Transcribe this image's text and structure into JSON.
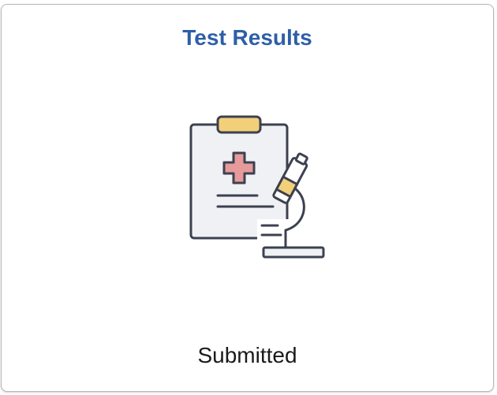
{
  "tile": {
    "title": "Test Results",
    "status": "Submitted",
    "icon": "clipboard-microscope-icon"
  },
  "colors": {
    "title": "#2e5ea8",
    "icon_stroke": "#3c4150",
    "clip": "#f3cf7a",
    "cross": "#e79a9a",
    "paper": "#f0f1f4",
    "eyepiece": "#f3cf7a"
  }
}
